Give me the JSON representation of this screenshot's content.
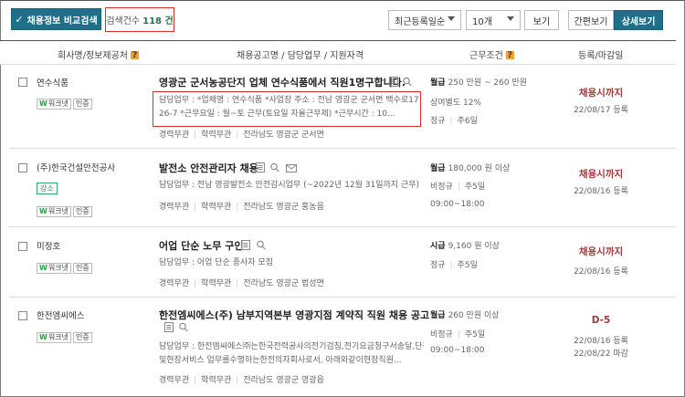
{
  "toolbar": {
    "compare_label": "채용정보 비교검색",
    "count_label": "검색건수",
    "count_value": "118 건",
    "sort_value": "최근등록일순",
    "per_page_value": "10개",
    "view_button": "보기",
    "simple_view": "간편보기",
    "detail_view": "상세보기"
  },
  "columns": {
    "company": "회사명/정보제공처",
    "posting": "채용공고명 / 담당업무 / 지원자격",
    "conditions": "근무조건",
    "deadline": "등록/마감일"
  },
  "rows": [
    {
      "company": "연수식품",
      "worknet": "워크넷",
      "cert": "인증",
      "title": "영광군 군서농공단지 업체 연수식품에서 직원1명구합니다.",
      "desc1": "담당업무 : *업체명 : 연수식품 *사업장 주소 : 전남 영광군 군서면 백수로17길",
      "desc2": "26-7 *근무요일 : 월~토 근무(토요일 자율근무제) *근무시간 : 10...",
      "career": "경력무관",
      "edu": "학력무관",
      "location": "전라남도 영광군 군서면",
      "wage_type": "월급",
      "wage": "250 만원 ~ 260 만원",
      "extra": "상여별도 12%",
      "employment": "정규",
      "days": "주6일",
      "status": "채용시까지",
      "date1": "22/08/17 등록",
      "date2": ""
    },
    {
      "company": "(주)한국건설안전공사",
      "tag": "강소",
      "worknet": "워크넷",
      "cert": "인증",
      "title": "발전소 안전관리자 채용",
      "desc1": "담당업무 : 전남 영광발전소 안전감시업무 (~2022년 12월 31일까지 근무)",
      "desc2": "",
      "career": "경력무관",
      "edu": "학력무관",
      "location": "전라남도 영광군 홍농읍",
      "wage_type": "월급",
      "wage": "180,000 원 이상",
      "extra": "",
      "employment": "비정규",
      "days": "주5일",
      "hours": "09:00~18:00",
      "status": "채용시까지",
      "date1": "22/08/16 등록",
      "date2": ""
    },
    {
      "company": "미정호",
      "worknet": "워크넷",
      "cert": "인증",
      "title": "어업 단순 노무 구인",
      "desc1": "담당업무 : 어업 단순 종사자 모집",
      "desc2": "",
      "career": "경력무관",
      "edu": "학력무관",
      "location": "전라남도 영광군 법성면",
      "wage_type": "시급",
      "wage": "9,160 원 이상",
      "extra": "",
      "employment": "정규",
      "days": "주5일",
      "status": "채용시까지",
      "date1": "22/08/16 등록",
      "date2": ""
    },
    {
      "company": "한전엠씨에스",
      "worknet": "워크넷",
      "cert": "인증",
      "title": "한전엠씨에스(주) 남부지역본부 영광지점 계약직 직원 채용 공고",
      "desc1": "담당업무 : 한전엠씨에스㈜는한국전력공사의전기검침,전기요금청구서송달,단전",
      "desc2": "및현장서비스 업무를수행하는한전의자회사로서, 아래와같이현장직원...",
      "career": "경력무관",
      "edu": "학력무관",
      "location": "전라남도 영광군 영광읍",
      "wage_type": "월급",
      "wage": "260 만원 이상",
      "extra": "",
      "employment": "비정규",
      "days": "주5일",
      "hours": "09:00~18:00",
      "status": "D-5",
      "date1": "22/08/16 등록",
      "date2": "22/08/22 마감"
    }
  ]
}
